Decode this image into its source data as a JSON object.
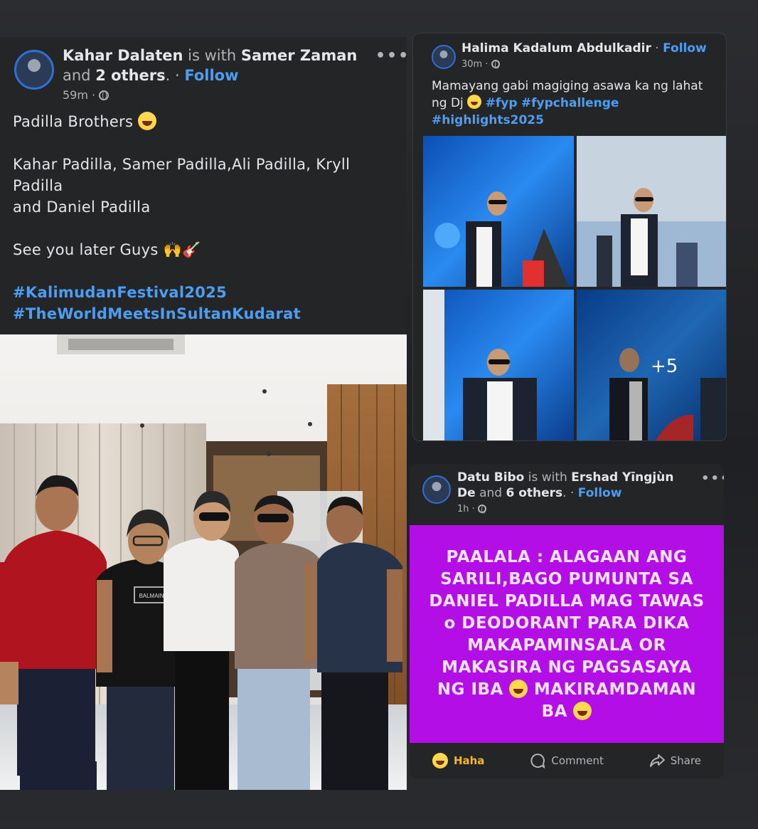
{
  "post1": {
    "author": "Kahar Dalaten",
    "with_word": "is with",
    "tagged": "Samer Zaman",
    "and_word": "and",
    "others": "2 others",
    "follow": "Follow",
    "time": "59m",
    "lines": {
      "l1": "Padilla Brothers",
      "l2": "Kahar Padilla, Samer Padilla,Ali Padilla, Kryll Padilla",
      "l3": "and Daniel Padilla",
      "l4": "See you later Guys"
    },
    "hashtags": [
      "#KalimudanFestival2025",
      "#TheWorldMeetsInSultanKudarat"
    ],
    "shirt_text": "BALMAIN"
  },
  "post2": {
    "author": "Halima Kadalum Abdulkadir",
    "follow": "Follow",
    "time": "30m",
    "text": "Mamayang gabi magiging asawa ka ng lahat ng Dj",
    "hashtags": [
      "#fyp",
      "#fypchallenge",
      "#highlights2025"
    ],
    "more_photos": "+5"
  },
  "post3": {
    "author": "Datu Bibo",
    "with_word": "is with",
    "tagged": "Ershad Yīngjùn De",
    "and_word": "and",
    "others": "6 others",
    "follow": "Follow",
    "time": "1h",
    "banner": {
      "l1": "PAALALA : ALAGAAN ANG",
      "l2": "SARILI,BAGO PUMUNTA SA",
      "l3": "DANIEL PADILLA MAG TAWAS",
      "l4": "o DEODORANT PARA DIKA",
      "l5": "MAKAPAMINSALA  OR",
      "l6": "MAKASIRA NG PAGSASAYA",
      "l7": "NG IBA",
      "l7b": "MAKIRAMDAMAN",
      "l8": "BA"
    },
    "actions": {
      "haha": "Haha",
      "comment": "Comment",
      "share": "Share"
    },
    "banner_color": "#b30ee6"
  },
  "colors": {
    "link": "#4c9ef5",
    "card": "#242526",
    "haha": "#f5b72b"
  }
}
